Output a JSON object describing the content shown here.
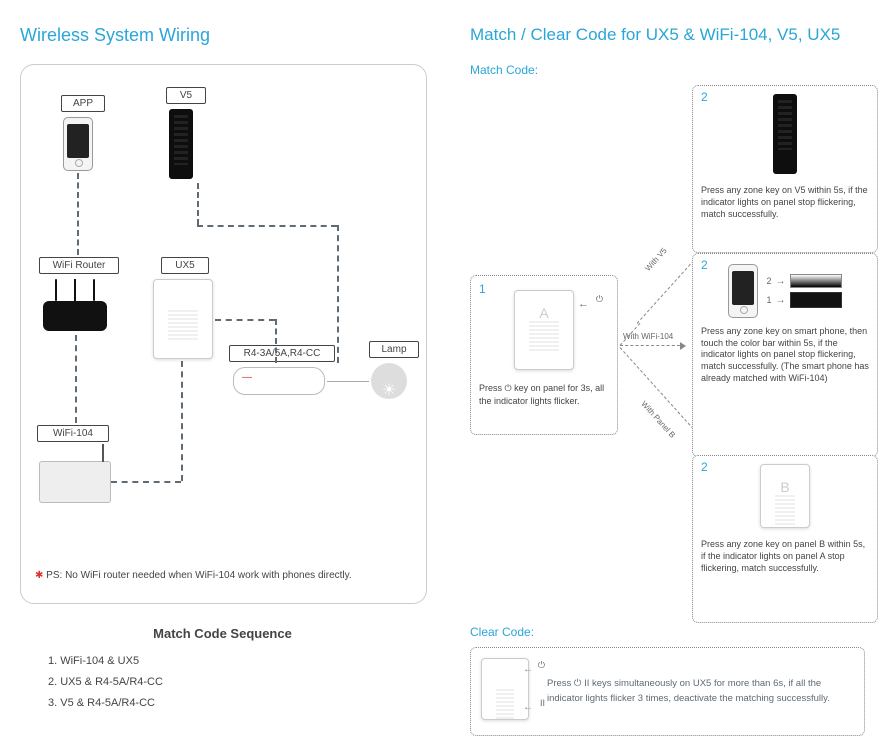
{
  "left": {
    "title": "Wireless System Wiring",
    "labels": {
      "app": "APP",
      "v5": "V5",
      "wifi_router": "WiFi Router",
      "ux5": "UX5",
      "receiver": "R4-3A/5A,R4-CC",
      "lamp": "Lamp",
      "wifi104": "WiFi-104"
    },
    "ps_note": "PS: No WiFi  router needed when WiFi-104 work with phones directly.",
    "seq_title": "Match Code Sequence",
    "seq_items": [
      "1. WiFi-104 & UX5",
      "2. UX5 & R4-5A/R4-CC",
      "3. V5 & R4-5A/R4-CC"
    ]
  },
  "right": {
    "title": "Match / Clear Code for UX5 & WiFi-104, V5, UX5",
    "match_heading": "Match Code:",
    "clear_heading": "Clear Code:",
    "step1": {
      "num": "1",
      "text": "Press ⏻ key on panel for 3s, all the indicator lights flicker."
    },
    "path_labels": {
      "v5": "With V5",
      "wifi": "With WiFi-104",
      "panelb": "With Panel B"
    },
    "step2_v5": {
      "num": "2",
      "text": "Press any zone key on V5 within 5s, if the indicator lights on panel stop flickering, match successfully."
    },
    "step2_wifi": {
      "num": "2",
      "annot_2": "2",
      "annot_1": "1",
      "text": "Press any zone key on smart phone, then touch the color bar within 5s, if the indicator lights on panel stop flickering, match successfully. (The smart phone has already matched with WiFi-104)"
    },
    "step2_panelb": {
      "num": "2",
      "text": "Press any zone key on panel B within 5s, if the indicator lights on panel A stop flickering, match successfully."
    },
    "clear": {
      "icon1": "⏻",
      "icon2": "II",
      "text": "Press ⏻ II keys simultaneously on UX5 for more than 6s, if all the indicator lights flicker 3 times, deactivate the matching successfully."
    }
  }
}
